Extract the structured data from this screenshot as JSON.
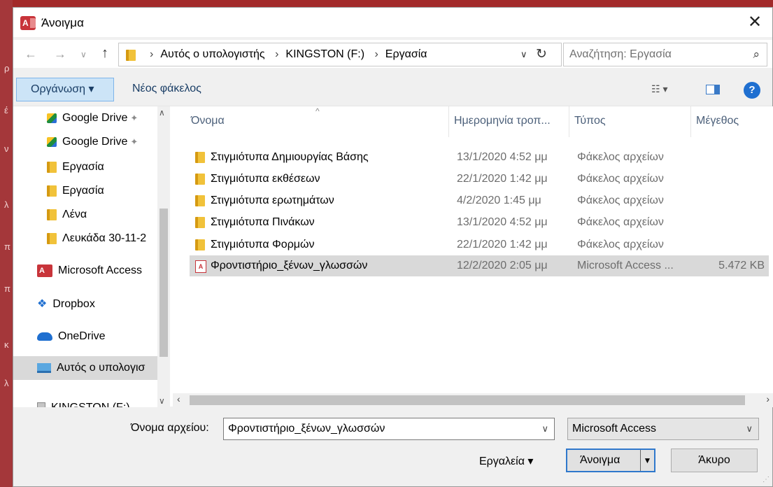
{
  "dialog": {
    "title": "Άνοιγμα",
    "app_badge": "A",
    "close_glyph": "✕"
  },
  "address": {
    "crumbs": [
      "Αυτός ο υπολογιστής",
      "KINGSTON (F:)",
      "Εργασία"
    ],
    "search_placeholder": "Αναζήτηση: Εργασία"
  },
  "toolbar": {
    "organize_label": "Οργάνωση ▾",
    "new_folder_label": "Νέος φάκελος",
    "help_label": "?"
  },
  "sidebar": {
    "items": [
      {
        "label": "Google Drive",
        "icon": "google-drive-icon",
        "pinned": true
      },
      {
        "label": "Google Drive",
        "icon": "google-drive-icon",
        "pinned": true
      },
      {
        "label": "Εργασία",
        "icon": "folder-icon"
      },
      {
        "label": "Εργασία",
        "icon": "folder-icon"
      },
      {
        "label": "Λένα",
        "icon": "folder-icon"
      },
      {
        "label": "Λευκάδα 30-11-2",
        "icon": "folder-icon"
      },
      {
        "label": "Microsoft Access",
        "icon": "access-icon"
      },
      {
        "label": "Dropbox",
        "icon": "dropbox-icon"
      },
      {
        "label": "OneDrive",
        "icon": "onedrive-icon"
      },
      {
        "label": "Αυτός ο υπολογισ",
        "icon": "this-pc-icon",
        "selected": true
      },
      {
        "label": "KINGSTON (F:)",
        "icon": "drive-icon"
      }
    ]
  },
  "files": {
    "columns": {
      "name": "Όνομα",
      "date": "Ημερομηνία τροπ...",
      "type": "Τύπος",
      "size": "Μέγεθος"
    },
    "rows": [
      {
        "name": "Στιγμιότυπα Δημιουργίας Βάσης",
        "date": "13/1/2020 4:52 μμ",
        "type": "Φάκελος αρχείων",
        "size": "",
        "icon": "folder-icon"
      },
      {
        "name": "Στιγμιότυπα εκθέσεων",
        "date": "22/1/2020 1:42 μμ",
        "type": "Φάκελος αρχείων",
        "size": "",
        "icon": "folder-icon"
      },
      {
        "name": "Στιγμιότυπα ερωτημάτων",
        "date": "4/2/2020 1:45 μμ",
        "type": "Φάκελος αρχείων",
        "size": "",
        "icon": "folder-icon"
      },
      {
        "name": "Στιγμιότυπα Πινάκων",
        "date": "13/1/2020 4:52 μμ",
        "type": "Φάκελος αρχείων",
        "size": "",
        "icon": "folder-icon"
      },
      {
        "name": "Στιγμιότυπα Φορμών",
        "date": "22/1/2020 1:42 μμ",
        "type": "Φάκελος αρχείων",
        "size": "",
        "icon": "folder-icon"
      },
      {
        "name": "Φροντιστήριο_ξένων_γλωσσών",
        "date": "12/2/2020 2:05 μμ",
        "type": "Microsoft Access ...",
        "size": "5.472 KB",
        "icon": "access-file-icon",
        "selected": true
      }
    ]
  },
  "footer": {
    "filename_label": "Όνομα αρχείου:",
    "filename_value": "Φροντιστήριο_ξένων_γλωσσών",
    "filter_value": "Microsoft Access",
    "tools_label": "Εργαλεία ▾",
    "open_label": "Άνοιγμα",
    "cancel_label": "Άκυρο"
  },
  "colors": {
    "accent": "#2f78cc",
    "access_red": "#c8343a",
    "selection": "#d9d9d9"
  }
}
